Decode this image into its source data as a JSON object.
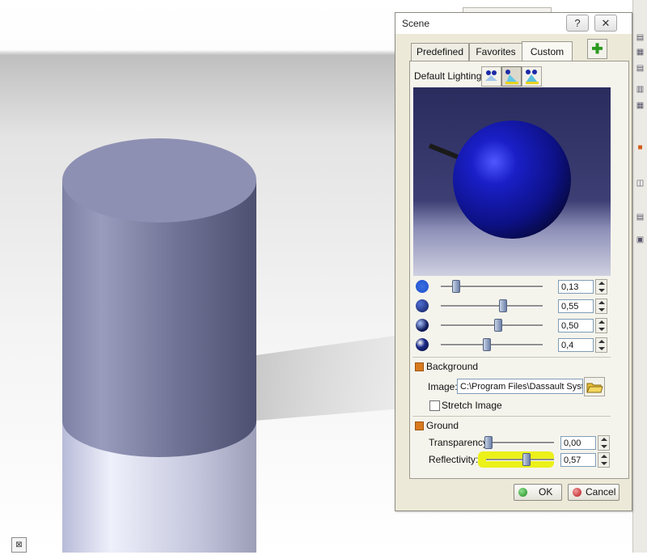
{
  "dialog": {
    "title": "Scene",
    "help_glyph": "?",
    "close_glyph": "✕",
    "tabs": [
      {
        "label": "Predefined",
        "active": false
      },
      {
        "label": "Favorites",
        "active": false
      },
      {
        "label": "Custom",
        "active": true
      }
    ],
    "add_glyph": "✚",
    "default_lighting_label": "Default Lighting:",
    "lighting_options": [
      {
        "icon": "single-light-icon",
        "selected": false
      },
      {
        "icon": "two-lights-icon",
        "selected": true
      },
      {
        "icon": "three-lights-icon",
        "selected": false
      }
    ],
    "sliders": [
      {
        "icon": "ambient-sphere-icon",
        "value": "0,13",
        "position": 0.13
      },
      {
        "icon": "diffuse-sphere-icon",
        "value": "0,55",
        "position": 0.55
      },
      {
        "icon": "specular-sphere-icon",
        "value": "0,50",
        "position": 0.5
      },
      {
        "icon": "shininess-sphere-icon",
        "value": "0,4",
        "position": 0.4
      }
    ],
    "background": {
      "section_label": "Background",
      "image_label": "Image:",
      "image_path": "C:\\Program Files\\Dassault Systèmes",
      "stretch_label": "Stretch Image",
      "stretch_checked": false
    },
    "ground": {
      "section_label": "Ground",
      "transparency_label": "Transparency:",
      "transparency_value": "0,00",
      "transparency_position": 0.0,
      "reflectivity_label": "Reflectivity:",
      "reflectivity_value": "0,57",
      "reflectivity_position": 0.57
    },
    "ok_label": "OK",
    "cancel_label": "Cancel"
  },
  "colors": {
    "dialog_bg": "#ece9d8",
    "panel_bg": "#f5f4ec",
    "section_orange": "#d97a1e",
    "highlight_yellow": "#eaf00e",
    "sphere_blue": "#1a1f9c",
    "cylinder_gray": "#8d8fb0",
    "ok_green": "#2e9a2e",
    "cancel_red": "#c2272d"
  }
}
